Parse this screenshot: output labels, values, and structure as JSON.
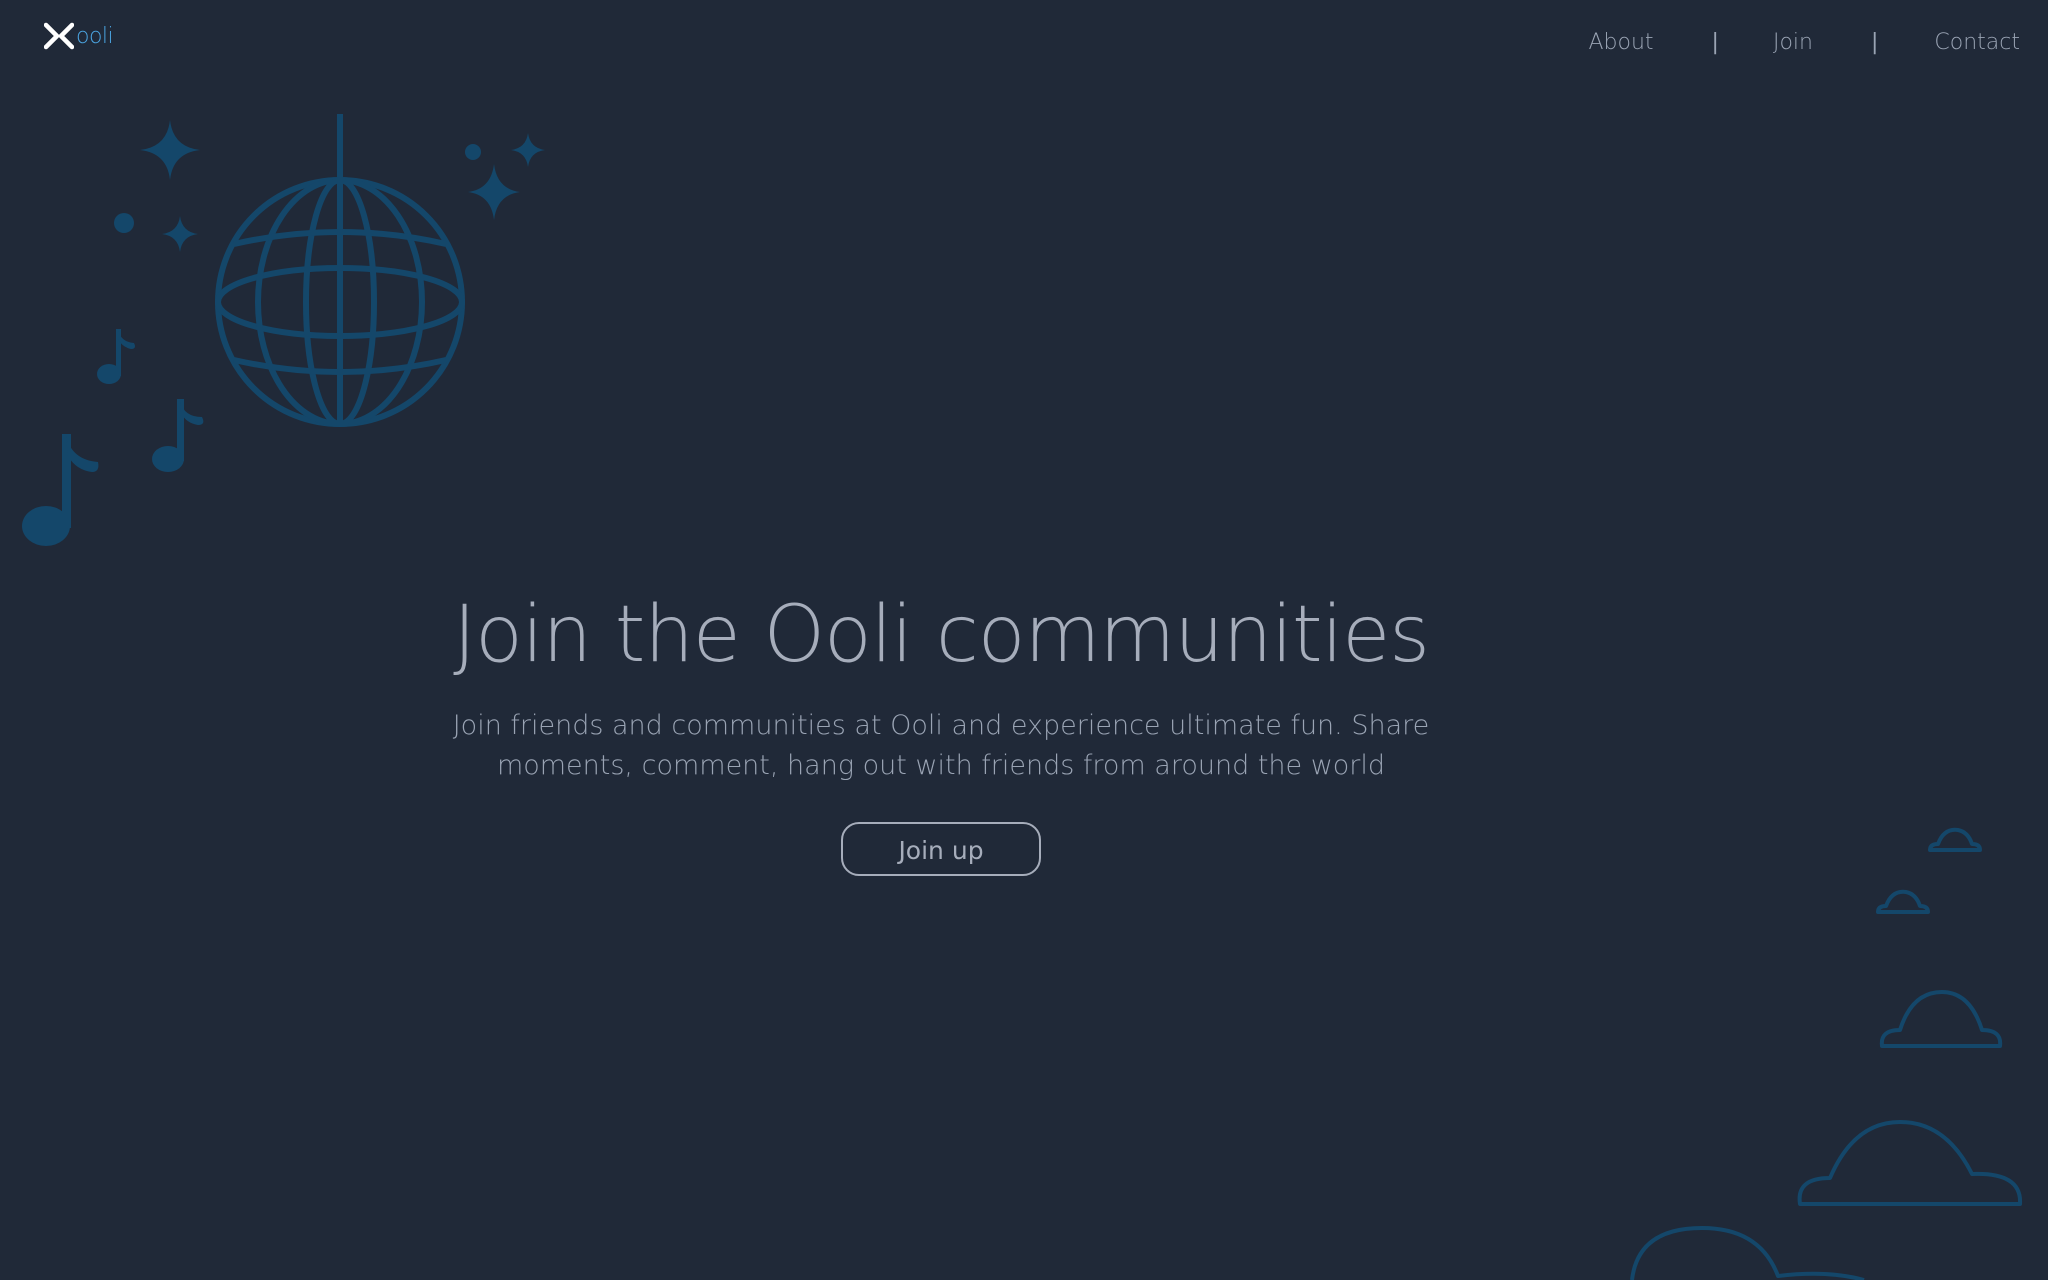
{
  "header": {
    "logo_text": "ooli",
    "nav": [
      {
        "label": "About"
      },
      {
        "label": "Join"
      },
      {
        "label": "Contact"
      }
    ],
    "separator": "|"
  },
  "hero": {
    "title": "Join the Ooli communities",
    "subtitle": "Join friends and communities at Ooli and experience ultimate fun. Share moments, comment, hang out with friends from around the world",
    "button_label": "Join up"
  },
  "decorations": {
    "top_left": [
      "disco-ball-icon",
      "sparkle-icon",
      "music-note-icon"
    ],
    "bottom_right": [
      "cloud-icon"
    ]
  },
  "colors": {
    "background": "#202938",
    "text": "#9aa4b4",
    "accent": "#4aa3df",
    "decoration": "#14476a"
  }
}
